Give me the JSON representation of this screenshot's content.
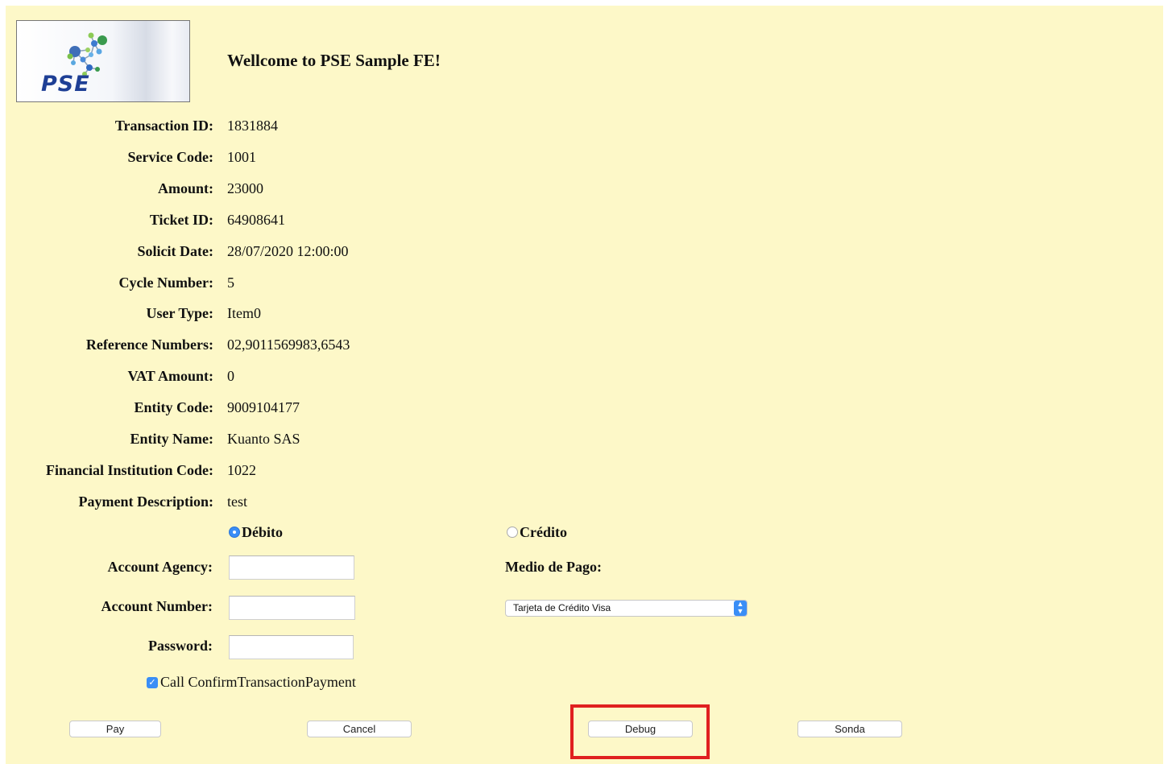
{
  "header": {
    "welcome": "Wellcome to PSE Sample FE!",
    "logo_text": "PSE"
  },
  "fields": [
    {
      "label": "Transaction ID:",
      "value": "1831884"
    },
    {
      "label": "Service Code:",
      "value": "1001"
    },
    {
      "label": "Amount:",
      "value": "23000"
    },
    {
      "label": "Ticket ID:",
      "value": "64908641"
    },
    {
      "label": "Solicit Date:",
      "value": "28/07/2020 12:00:00"
    },
    {
      "label": "Cycle Number:",
      "value": "5"
    },
    {
      "label": "User Type:",
      "value": "Item0"
    },
    {
      "label": "Reference Numbers:",
      "value": "02,9011569983,6543"
    },
    {
      "label": "VAT Amount:",
      "value": "0"
    },
    {
      "label": "Entity Code:",
      "value": "9009104177"
    },
    {
      "label": "Entity Name:",
      "value": "Kuanto SAS"
    },
    {
      "label": "Financial Institution Code:",
      "value": "1022"
    },
    {
      "label": "Payment Description:",
      "value": "test"
    }
  ],
  "payment_type": {
    "debit_label": "Débito",
    "credit_label": "Crédito",
    "selected": "debit"
  },
  "form": {
    "account_agency_label": "Account Agency:",
    "account_agency_value": "",
    "account_number_label": "Account Number:",
    "account_number_value": "",
    "password_label": "Password:",
    "password_value": "",
    "medio_label": "Medio de Pago:",
    "medio_selected": "Tarjeta de Crédito Visa",
    "confirm_checkbox_label": "Call ConfirmTransactionPayment",
    "confirm_checked": true
  },
  "buttons": {
    "pay": "Pay",
    "cancel": "Cancel",
    "debug": "Debug",
    "sonda": "Sonda"
  },
  "colors": {
    "background": "#fdf8c8",
    "accent": "#3a8ef6",
    "highlight": "#e02020"
  }
}
